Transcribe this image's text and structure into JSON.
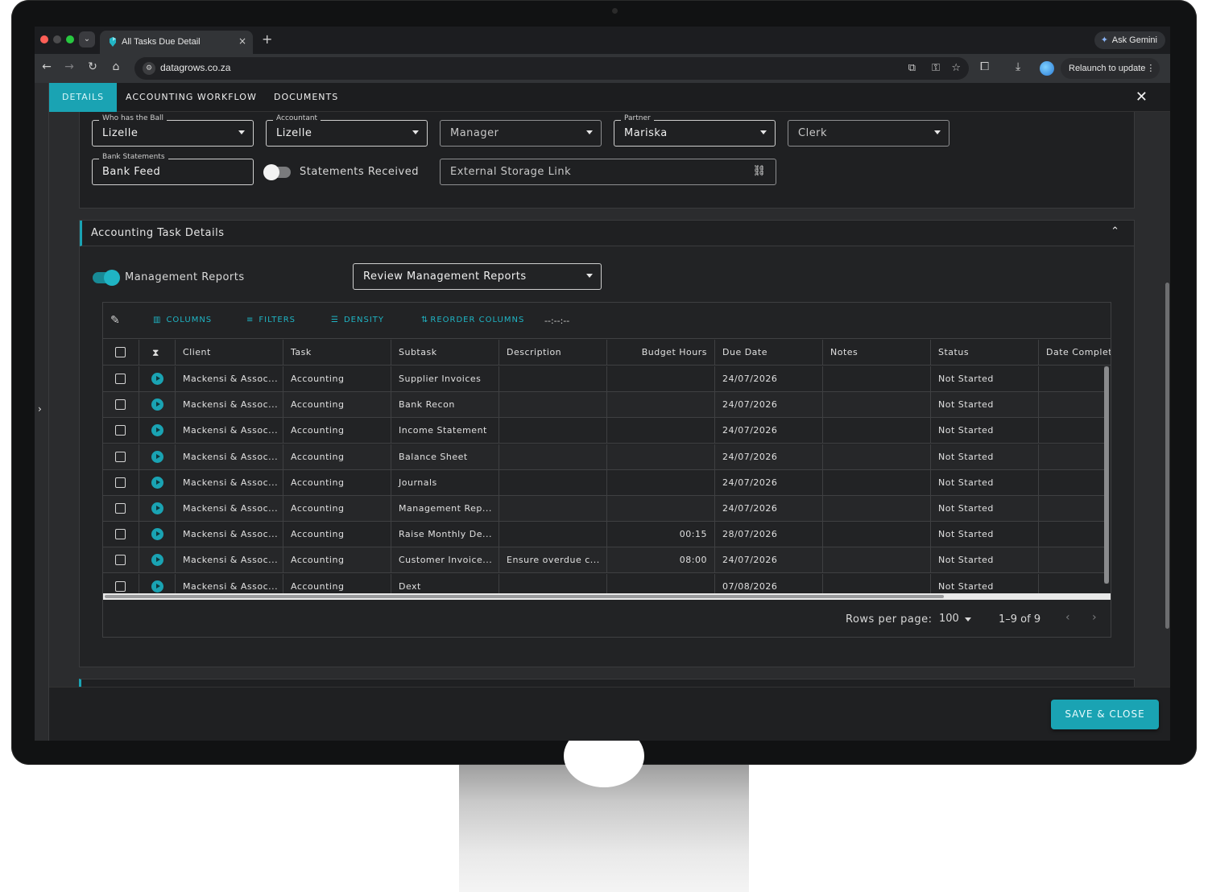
{
  "browser": {
    "tab_title": "All Tasks Due Detail",
    "tab_close": "×",
    "new_tab": "+",
    "gemini_label": "Ask Gemini",
    "url": "datagrows.co.za",
    "relaunch_label": "Relaunch to update"
  },
  "dialog": {
    "tabs": [
      "DETAILS",
      "ACCOUNTING WORKFLOW",
      "DOCUMENTS"
    ],
    "active_tab": "DETAILS",
    "close": "✕"
  },
  "fields": {
    "who_has_ball": {
      "label": "Who has the Ball",
      "value": "Lizelle"
    },
    "accountant": {
      "label": "Accountant",
      "value": "Lizelle"
    },
    "manager": {
      "placeholder": "Manager"
    },
    "partner": {
      "label": "Partner",
      "value": "Mariska"
    },
    "clerk": {
      "placeholder": "Clerk"
    },
    "bank_statements": {
      "label": "Bank Statements",
      "value": "Bank Feed"
    },
    "statements_received": {
      "label": "Statements Received",
      "on": false
    },
    "external_storage": {
      "placeholder": "External Storage Link"
    }
  },
  "task_details": {
    "title": "Accounting Task Details",
    "management_reports": {
      "label": "Management Reports",
      "on": true
    },
    "review_select": "Review Management Reports"
  },
  "grid": {
    "toolbar": {
      "columns": "COLUMNS",
      "filters": "FILTERS",
      "density": "DENSITY",
      "reorder": "REORDER COLUMNS",
      "timer": "--:--:--"
    },
    "headers": [
      "Client",
      "Task",
      "Subtask",
      "Description",
      "Budget Hours",
      "Due Date",
      "Notes",
      "Status",
      "Date Complet"
    ],
    "rows": [
      {
        "client": "Mackensi & Assoc...",
        "task": "Accounting",
        "subtask": "Supplier Invoices",
        "description": "",
        "budget": "",
        "due": "24/07/2026",
        "notes": "",
        "status": "Not Started",
        "completed": ""
      },
      {
        "client": "Mackensi & Assoc...",
        "task": "Accounting",
        "subtask": "Bank Recon",
        "description": "",
        "budget": "",
        "due": "24/07/2026",
        "notes": "",
        "status": "Not Started",
        "completed": ""
      },
      {
        "client": "Mackensi & Assoc...",
        "task": "Accounting",
        "subtask": "Income Statement",
        "description": "",
        "budget": "",
        "due": "24/07/2026",
        "notes": "",
        "status": "Not Started",
        "completed": ""
      },
      {
        "client": "Mackensi & Assoc...",
        "task": "Accounting",
        "subtask": "Balance Sheet",
        "description": "",
        "budget": "",
        "due": "24/07/2026",
        "notes": "",
        "status": "Not Started",
        "completed": ""
      },
      {
        "client": "Mackensi & Assoc...",
        "task": "Accounting",
        "subtask": "Journals",
        "description": "",
        "budget": "",
        "due": "24/07/2026",
        "notes": "",
        "status": "Not Started",
        "completed": ""
      },
      {
        "client": "Mackensi & Assoc...",
        "task": "Accounting",
        "subtask": "Management Rep...",
        "description": "",
        "budget": "",
        "due": "24/07/2026",
        "notes": "",
        "status": "Not Started",
        "completed": ""
      },
      {
        "client": "Mackensi & Assoc...",
        "task": "Accounting",
        "subtask": "Raise Monthly De...",
        "description": "",
        "budget": "00:15",
        "due": "28/07/2026",
        "notes": "",
        "status": "Not Started",
        "completed": ""
      },
      {
        "client": "Mackensi & Assoc...",
        "task": "Accounting",
        "subtask": "Customer Invoice...",
        "description": "Ensure overdue c...",
        "budget": "08:00",
        "due": "24/07/2026",
        "notes": "",
        "status": "Not Started",
        "completed": ""
      },
      {
        "client": "Mackensi & Assoc...",
        "task": "Accounting",
        "subtask": "Dext",
        "description": "",
        "budget": "",
        "due": "07/08/2026",
        "notes": "",
        "status": "Not Started",
        "completed": ""
      }
    ],
    "footer": {
      "rows_per_page_label": "Rows per page:",
      "rows_per_page": "100",
      "range": "1–9 of 9"
    }
  },
  "footer": {
    "save_close": "SAVE & CLOSE"
  },
  "colors": {
    "accent": "#1aa3b3",
    "background": "#1f2022"
  }
}
